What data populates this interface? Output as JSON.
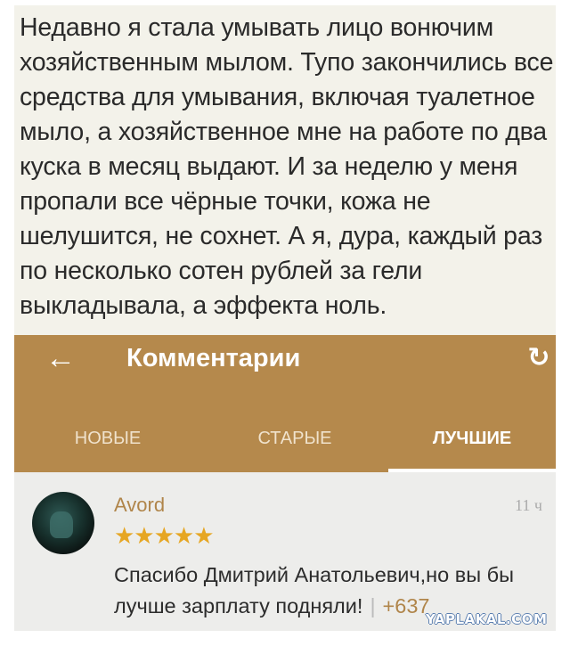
{
  "post": {
    "text": "Недавно я стала умывать лицо вонючим хозяйственным мылом. Тупо закончились все средства для умывания, включая туалетное мыло, а хозяйственное мне на работе по два куска в месяц выдают. И за неделю у меня пропали все чёрные точки, кожа не шелушится, не сохнет. А я, дура, каждый раз по несколько сотен рублей за гели выкладывала, а эффекта ноль."
  },
  "header": {
    "title": "Комментарии",
    "back_icon": "arrow-left-icon",
    "refresh_icon": "refresh-icon"
  },
  "tabs": [
    {
      "label": "НОВЫЕ"
    },
    {
      "label": "СТАРЫЕ"
    },
    {
      "label": "ЛУЧШИЕ",
      "active": true
    }
  ],
  "comment": {
    "author": "Avord",
    "time": "11 ч",
    "stars": "★★★★★",
    "rating": 5,
    "text": "Спасибо Дмитрий Анатольевич,но вы бы лучше зарплату подняли!",
    "separator": "|",
    "score": "+637"
  },
  "watermark": "YAPLAKAL.COM",
  "colors": {
    "appbar": "#b5894c",
    "accent": "#b0854a",
    "star": "#e6a623",
    "post_bg": "#f3f2ea"
  }
}
